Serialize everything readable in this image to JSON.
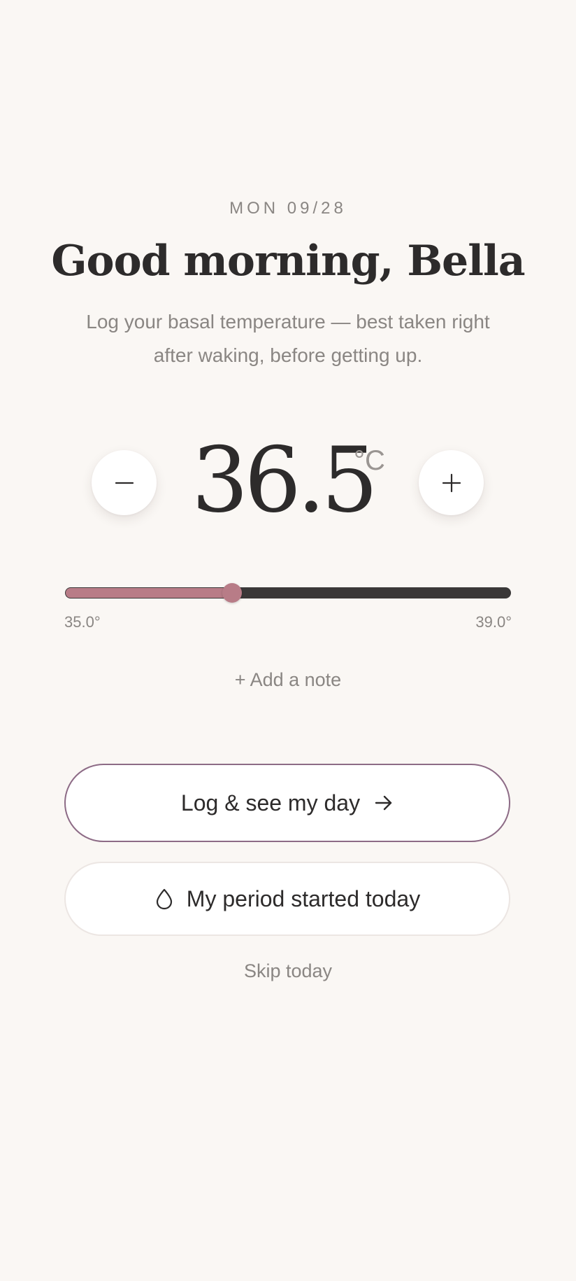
{
  "header": {
    "date": "MON 09/28",
    "greeting": "Good morning, Bella",
    "subtitle": "Log your basal temperature — best taken right after waking, before getting up."
  },
  "temperature": {
    "value": "36.5",
    "unit": "°C",
    "decrement_icon": "minus-icon",
    "increment_icon": "plus-icon"
  },
  "slider": {
    "min": 35.0,
    "max": 39.0,
    "value": 36.5,
    "min_label": "35.0°",
    "max_label": "39.0°",
    "fill_color": "#b87c87",
    "track_color": "#3a3838"
  },
  "add_note": "+ Add a note",
  "actions": {
    "primary_label": "Log & see my day",
    "primary_icon": "arrow-right-icon",
    "secondary_label": "My period started today",
    "secondary_icon": "drop-icon",
    "skip_label": "Skip today"
  },
  "colors": {
    "background": "#faf7f4",
    "accent": "#b87c87",
    "primary_border": "#8d6b86",
    "text": "#2d2b2b",
    "muted_text": "#8a8683"
  }
}
